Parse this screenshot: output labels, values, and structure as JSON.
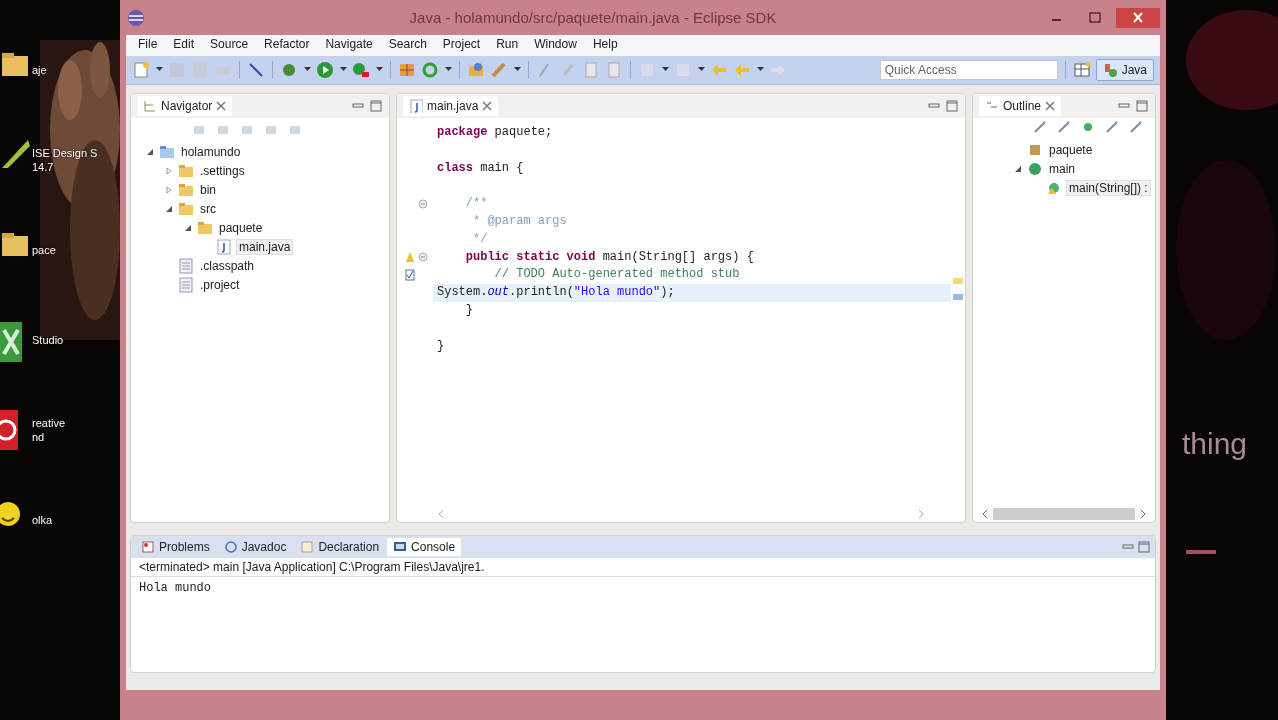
{
  "desktop": {
    "icons": [
      {
        "kind": "folder",
        "lines": [
          "aje"
        ]
      },
      {
        "kind": "chip",
        "lines": [
          "ISE Design S",
          "14.7"
        ]
      },
      {
        "kind": "folder",
        "lines": [
          "pace"
        ]
      },
      {
        "kind": "studio",
        "lines": [
          "Studio"
        ]
      },
      {
        "kind": "creative",
        "lines": [
          "reative",
          "nd"
        ]
      },
      {
        "kind": "smiley",
        "lines": [
          "olka"
        ]
      }
    ],
    "side_text": "thing"
  },
  "window": {
    "title": "Java - holamundo/src/paquete/main.java - Eclipse SDK"
  },
  "menu": [
    "File",
    "Edit",
    "Source",
    "Refactor",
    "Navigate",
    "Search",
    "Project",
    "Run",
    "Window",
    "Help"
  ],
  "quick_access": {
    "placeholder": "Quick Access"
  },
  "perspective": {
    "label": "Java",
    "selected": true
  },
  "navigator": {
    "tab": "Navigator",
    "tree": [
      {
        "label": "holamundo",
        "kind": "project",
        "expanded": true,
        "selected": false,
        "children": [
          {
            "label": ".settings",
            "kind": "folder",
            "expanded": false,
            "selected": false
          },
          {
            "label": "bin",
            "kind": "folder",
            "expanded": false,
            "selected": false
          },
          {
            "label": "src",
            "kind": "folder",
            "expanded": true,
            "selected": false,
            "children": [
              {
                "label": "paquete",
                "kind": "folder",
                "expanded": true,
                "selected": false,
                "children": [
                  {
                    "label": "main.java",
                    "kind": "java",
                    "selected": true
                  }
                ]
              }
            ]
          },
          {
            "label": ".classpath",
            "kind": "file",
            "selected": false
          },
          {
            "label": ".project",
            "kind": "file",
            "selected": false
          }
        ]
      }
    ]
  },
  "editor": {
    "tab": "main.java",
    "lines": [
      {
        "tokens": [
          {
            "kind": "keyword",
            "text": "package"
          },
          {
            "kind": "plain",
            "text": " paquete;"
          }
        ]
      },
      {
        "blank_before": true,
        "tokens": [
          {
            "kind": "keyword",
            "text": "class"
          },
          {
            "kind": "plain",
            "text": " main {"
          }
        ]
      },
      {
        "blank_before": true,
        "fold": true,
        "tokens": [
          {
            "kind": "doc",
            "text": "    /**"
          }
        ]
      },
      {
        "tokens": [
          {
            "kind": "doc",
            "text": "     * @param args"
          }
        ]
      },
      {
        "tokens": [
          {
            "kind": "doc",
            "text": "     */"
          }
        ]
      },
      {
        "fold": true,
        "warning": true,
        "tokens": [
          {
            "kind": "keyword",
            "text": "    public static void"
          },
          {
            "kind": "plain",
            "text": " main(String[] args) {"
          }
        ]
      },
      {
        "task": true,
        "tokens": [
          {
            "kind": "comment",
            "text": "        // TODO Auto-generated method stub"
          }
        ]
      },
      {
        "current": true,
        "tokens": [
          {
            "kind": "plain",
            "text": "System."
          },
          {
            "kind": "field",
            "text": "out"
          },
          {
            "kind": "plain",
            "text": ".println("
          },
          {
            "kind": "string",
            "text": "\"Hola mundo\""
          },
          {
            "kind": "plain",
            "text": ");"
          }
        ]
      },
      {
        "tokens": [
          {
            "kind": "plain",
            "text": "    }"
          }
        ]
      },
      {
        "blank_before": true,
        "tokens": [
          {
            "kind": "plain",
            "text": "}"
          }
        ]
      }
    ]
  },
  "outline": {
    "tab": "Outline",
    "tree": [
      {
        "label": "paquete",
        "kind": "package",
        "selected": false
      },
      {
        "label": "main",
        "kind": "class",
        "expanded": true,
        "selected": false,
        "children": [
          {
            "label": "main(String[]) :",
            "kind": "method",
            "selected": true
          }
        ]
      }
    ]
  },
  "bottom": {
    "tabs": [
      {
        "label": "Problems",
        "kind": "problems",
        "selected": false
      },
      {
        "label": "Javadoc",
        "kind": "javadoc",
        "selected": false
      },
      {
        "label": "Declaration",
        "kind": "declaration",
        "selected": false
      },
      {
        "label": "Console",
        "kind": "console",
        "selected": true
      }
    ],
    "header": "<terminated> main [Java Application] C:\\Program Files\\Java\\jre1.",
    "output": "Hola mundo"
  }
}
